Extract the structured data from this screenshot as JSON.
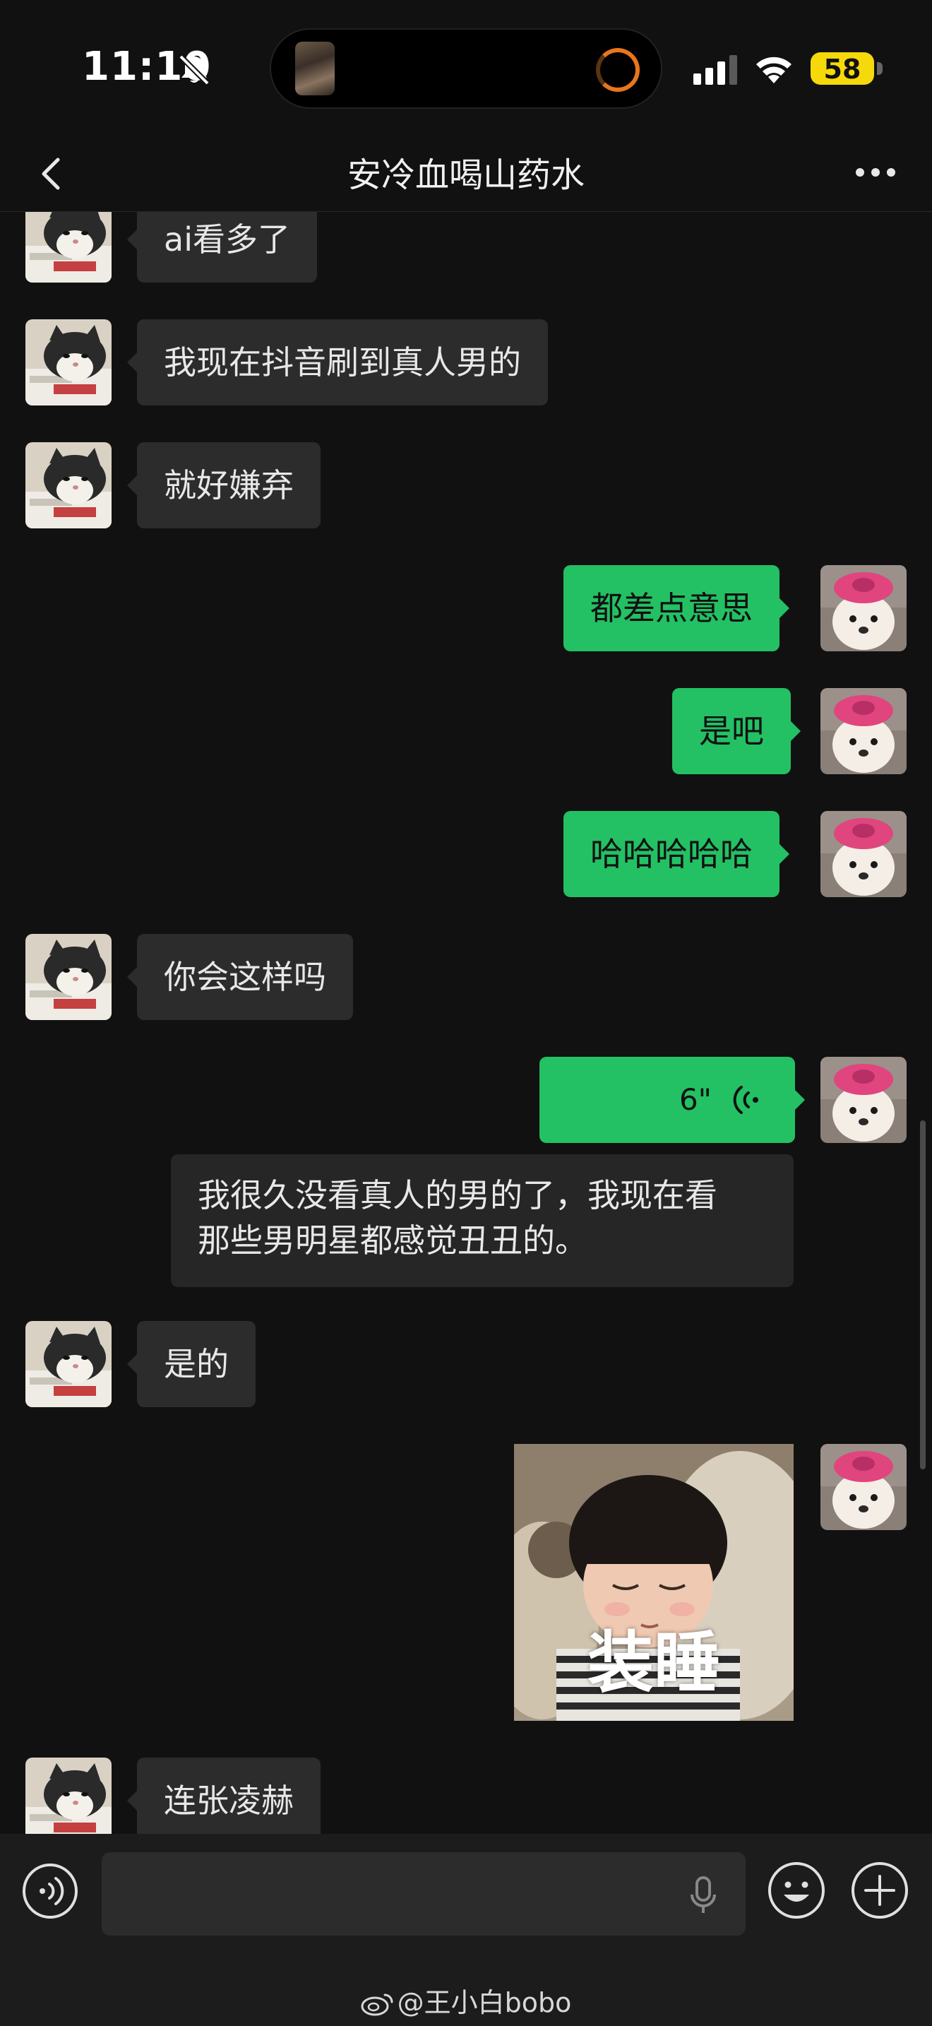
{
  "status_bar": {
    "time": "11:10",
    "battery": "58"
  },
  "header": {
    "title": "安冷血喝山药水"
  },
  "messages": [
    {
      "side": "in",
      "text": "ai看多了"
    },
    {
      "side": "in",
      "text": "我现在抖音刷到真人男的"
    },
    {
      "side": "in",
      "text": "就好嫌弃"
    },
    {
      "side": "out",
      "text": "都差点意思"
    },
    {
      "side": "out",
      "text": "是吧"
    },
    {
      "side": "out",
      "text": "哈哈哈哈哈"
    },
    {
      "side": "in",
      "text": "你会这样吗"
    },
    {
      "side": "out",
      "type": "voice",
      "duration": "6\""
    },
    {
      "side": "out",
      "type": "transcript",
      "line1": "我很久没看真人的男的了，我现在看",
      "line2": "那些男明星都感觉丑丑的。"
    },
    {
      "side": "in",
      "text": "是的"
    },
    {
      "side": "out",
      "type": "sticker",
      "caption": "装睡"
    },
    {
      "side": "in",
      "text": "连张凌赫"
    }
  ],
  "watermark": "@王小白bobo",
  "colors": {
    "outgoing_bubble": "#23c164",
    "incoming_bubble": "#2c2c2c",
    "background": "#111111"
  }
}
